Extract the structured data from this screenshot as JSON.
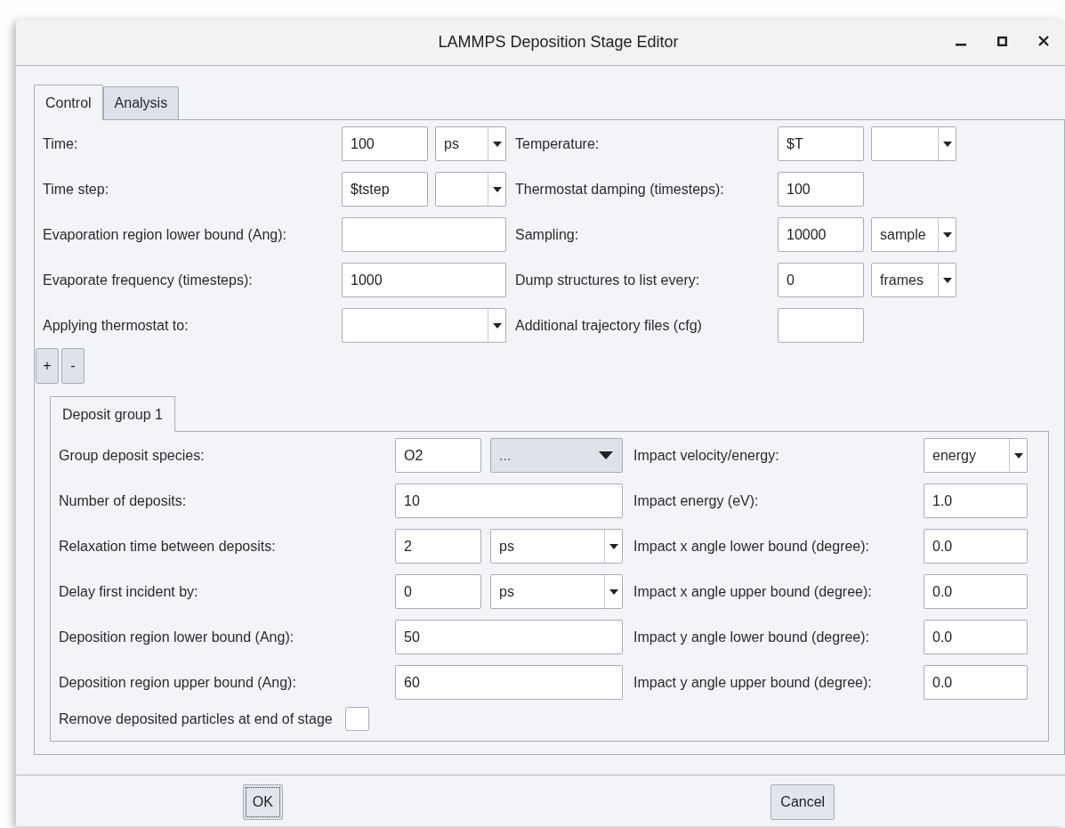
{
  "window": {
    "title": "LAMMPS Deposition Stage Editor"
  },
  "tabs": [
    {
      "label": "Control",
      "selected": true
    },
    {
      "label": "Analysis",
      "selected": false
    }
  ],
  "control_rows": [
    {
      "left": {
        "label": "Time:",
        "widgets": [
          {
            "kind": "input",
            "value": "100"
          },
          {
            "kind": "combo",
            "value": "ps"
          }
        ]
      },
      "right": {
        "label": "Temperature:",
        "widgets": [
          {
            "kind": "input",
            "value": "$T"
          },
          {
            "kind": "combo"
          }
        ]
      }
    },
    {
      "left": {
        "label": "Time step:",
        "widgets": [
          {
            "kind": "input",
            "value": "$tstep"
          },
          {
            "kind": "combo"
          }
        ]
      },
      "right": {
        "label": "Thermostat damping (timesteps):",
        "widgets": [
          {
            "kind": "input",
            "value": "100"
          }
        ]
      }
    },
    {
      "left": {
        "label": "Evaporation region lower bound (Ang):",
        "widgets": [
          {
            "kind": "input"
          }
        ]
      },
      "right": {
        "label": "Sampling:",
        "widgets": [
          {
            "kind": "input",
            "value": "10000"
          },
          {
            "kind": "combo",
            "value": "sample"
          }
        ]
      }
    },
    {
      "left": {
        "label": "Evaporate frequency (timesteps):",
        "widgets": [
          {
            "kind": "input",
            "value": "1000"
          }
        ]
      },
      "right": {
        "label": "Dump structures to list every:",
        "widgets": [
          {
            "kind": "input",
            "value": "0"
          },
          {
            "kind": "combo",
            "value": "frames"
          }
        ]
      }
    },
    {
      "left": {
        "label": "Applying thermostat to:",
        "widgets": [
          {
            "kind": "combo"
          }
        ]
      },
      "right": {
        "label": "Additional trajectory files (cfg)",
        "widgets": [
          {
            "kind": "input"
          }
        ]
      }
    }
  ],
  "group_buttons": [
    "+",
    "-"
  ],
  "group_tabs": [
    {
      "label": "Deposit group 1",
      "selected": true
    }
  ],
  "deposit_rows": [
    {
      "left": {
        "label": "Group deposit species:",
        "widgets": [
          {
            "kind": "input",
            "value": "O2"
          },
          {
            "kind": "menu",
            "value": "..."
          }
        ]
      },
      "right": {
        "label": "Impact velocity/energy:",
        "widgets": [
          {
            "kind": "combo",
            "value": "energy"
          }
        ]
      }
    },
    {
      "left": {
        "label": "Number of deposits:",
        "widgets": [
          {
            "kind": "input",
            "value": "10"
          }
        ]
      },
      "right": {
        "label": "Impact energy (eV):",
        "widgets": [
          {
            "kind": "input",
            "value": "1.0"
          }
        ]
      }
    },
    {
      "left": {
        "label": "Relaxation time between deposits:",
        "widgets": [
          {
            "kind": "input",
            "value": "2"
          },
          {
            "kind": "combo",
            "value": "ps"
          }
        ]
      },
      "right": {
        "label": "Impact x angle lower bound (degree):",
        "widgets": [
          {
            "kind": "input",
            "value": "0.0"
          }
        ]
      }
    },
    {
      "left": {
        "label": "Delay first incident by:",
        "widgets": [
          {
            "kind": "input",
            "value": "0"
          },
          {
            "kind": "combo",
            "value": "ps"
          }
        ]
      },
      "right": {
        "label": "Impact x angle upper bound (degree):",
        "widgets": [
          {
            "kind": "input",
            "value": "0.0"
          }
        ]
      }
    },
    {
      "left": {
        "label": "Deposition region lower bound (Ang):",
        "widgets": [
          {
            "kind": "input",
            "value": "50"
          }
        ]
      },
      "right": {
        "label": "Impact y angle lower bound (degree):",
        "widgets": [
          {
            "kind": "input",
            "value": "0.0"
          }
        ]
      }
    },
    {
      "left": {
        "label": "Deposition region upper bound (Ang):",
        "widgets": [
          {
            "kind": "input",
            "value": "60"
          }
        ]
      },
      "right": {
        "label": "Impact y angle upper bound (degree):",
        "widgets": [
          {
            "kind": "input",
            "value": "0.0"
          }
        ]
      }
    },
    {
      "left": {
        "label": "Remove deposited particles at end of stage",
        "widgets": [
          {
            "kind": "checkbox",
            "checked": false
          }
        ]
      }
    }
  ],
  "buttons": [
    {
      "label": "OK",
      "focused": true
    },
    {
      "label": "Cancel",
      "focused": false
    }
  ]
}
